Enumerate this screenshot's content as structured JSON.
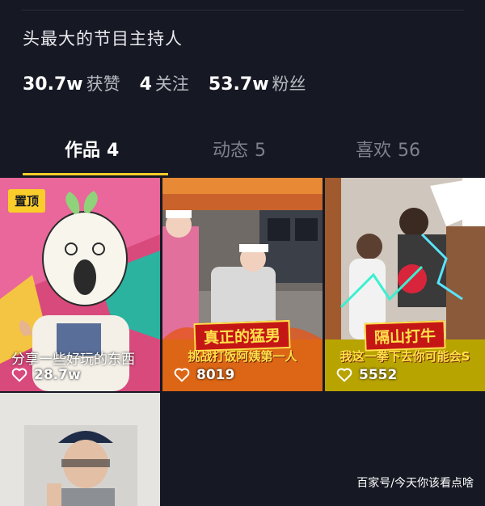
{
  "profile": {
    "bio": "头最大的节目主持人",
    "stats": [
      {
        "value": "30.7w",
        "label": "获赞"
      },
      {
        "value": "4",
        "label": "关注"
      },
      {
        "value": "53.7w",
        "label": "粉丝"
      }
    ]
  },
  "tabs": [
    {
      "label": "作品",
      "count": "4",
      "active": true
    },
    {
      "label": "动态",
      "count": "5",
      "active": false
    },
    {
      "label": "喜欢",
      "count": "56",
      "active": false
    }
  ],
  "videos": [
    {
      "pinned_label": "置顶",
      "caption": "分享一些好玩的东西",
      "likes": "28.7w"
    },
    {
      "banner_title": "真正的猛男",
      "banner_sub": "挑战打饭阿姨第一人",
      "likes": "8019"
    },
    {
      "banner_title": "隔山打牛",
      "banner_sub": "我这一拳下去你可能会S",
      "likes": "5552"
    },
    {}
  ],
  "watermark": "百家号/今天你该看点啥",
  "colors": {
    "background": "#161823",
    "accent": "#facd2a"
  }
}
